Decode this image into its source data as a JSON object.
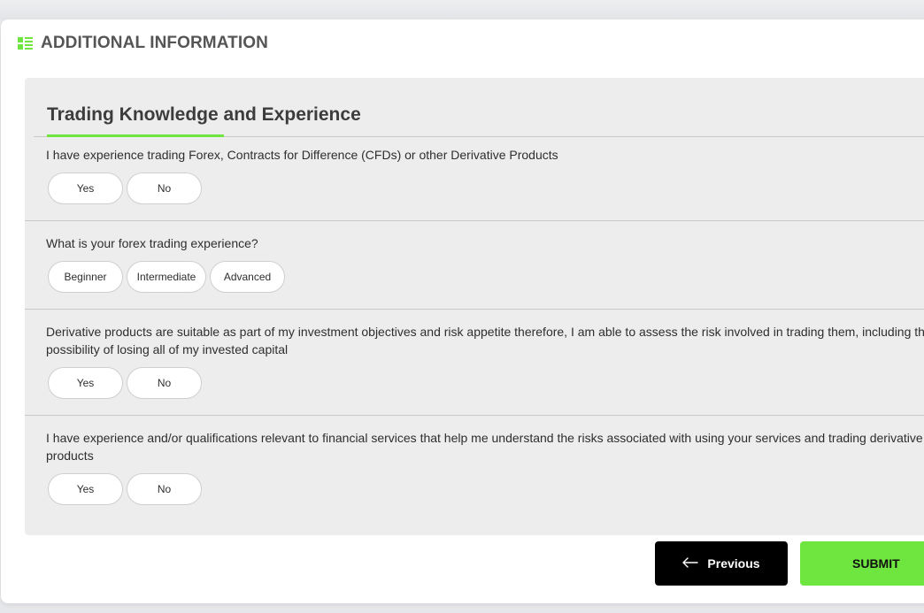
{
  "header": {
    "icon": "list-icon",
    "title": "ADDITIONAL INFORMATION"
  },
  "section": {
    "title": "Trading Knowledge and Experience",
    "questions": [
      {
        "text": "I have experience trading Forex, Contracts for Difference (CFDs) or other Derivative Products",
        "options": [
          "Yes",
          "No"
        ]
      },
      {
        "text": "What is your forex trading experience?",
        "options": [
          "Beginner",
          "Intermediate",
          "Advanced"
        ]
      },
      {
        "text": "Derivative products are suitable as part of my investment objectives and risk appetite therefore, I am able to assess the risk involved in trading them, including the possibility of losing all of my invested capital",
        "options": [
          "Yes",
          "No"
        ]
      },
      {
        "text": "I have experience and/or qualifications relevant to financial services that help me understand the risks associated with using your services and trading derivative products",
        "options": [
          "Yes",
          "No"
        ]
      }
    ]
  },
  "footer": {
    "previous_label": "Previous",
    "previous_icon": "arrow-left-icon",
    "submit_label": "SUBMIT"
  },
  "colors": {
    "accent": "#6ee63f",
    "panel": "#ededed",
    "primary_button": "#000000"
  }
}
